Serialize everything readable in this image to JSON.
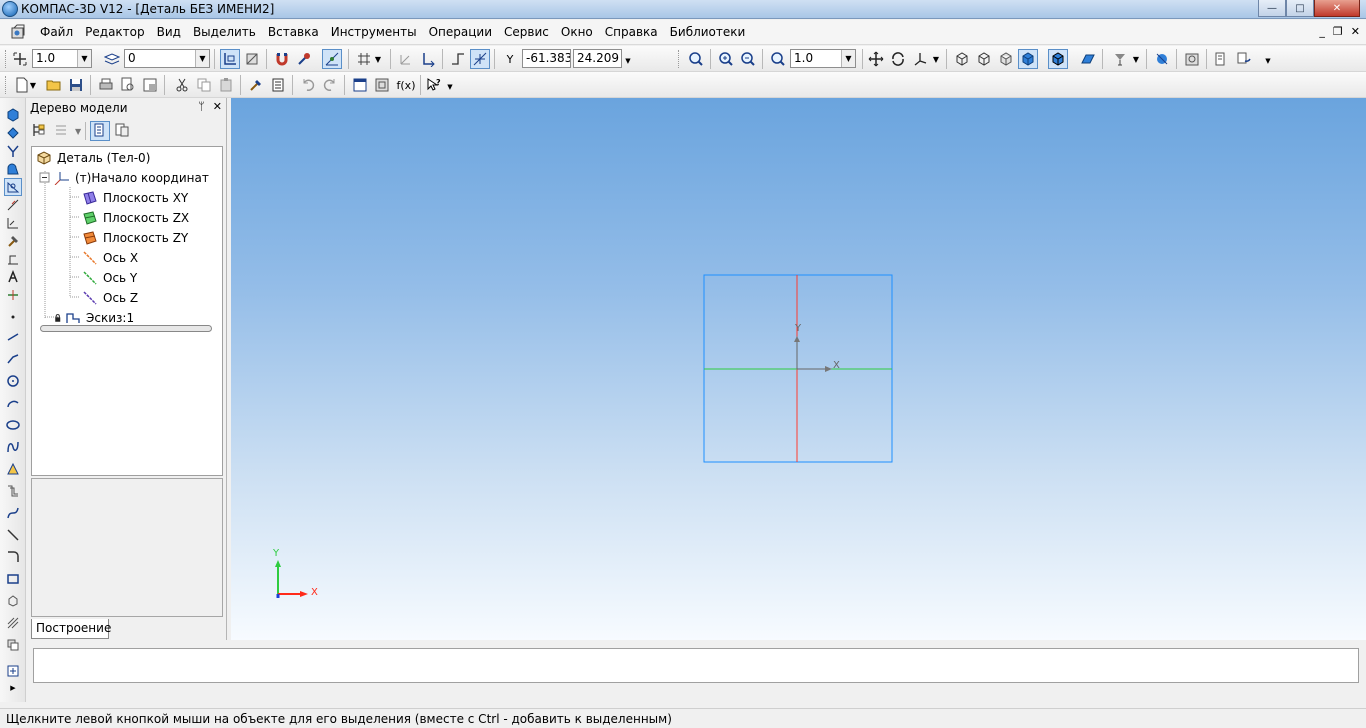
{
  "window": {
    "title": "КОМПАС-3D V12 - [Деталь БЕЗ ИМЕНИ2]",
    "controls": {
      "minimize": "—",
      "maximize": "□",
      "close": "✕"
    }
  },
  "menu": {
    "items": [
      "Файл",
      "Редактор",
      "Вид",
      "Выделить",
      "Вставка",
      "Инструменты",
      "Операции",
      "Сервис",
      "Окно",
      "Справка",
      "Библиотеки"
    ],
    "mdi_controls": {
      "minimize": "_",
      "restore": "❐",
      "close": "✕"
    }
  },
  "toolbar": {
    "step_value": "1.0",
    "layer_value": "0",
    "coord_y_label": "Y",
    "coord_x": "-61.383",
    "coord_y": "24.209",
    "zoom_value": "1.0",
    "fx_label": "f(x)"
  },
  "tree_panel": {
    "title": "Дерево модели",
    "pin": "ᛘ",
    "close": "✕",
    "nodes": [
      {
        "label": "Деталь (Тел-0)",
        "icon": "part-icon"
      },
      {
        "label": "(т)Начало координат",
        "icon": "origin-icon"
      },
      {
        "label": "Плоскость XY",
        "icon": "plane-xy-icon"
      },
      {
        "label": "Плоскость ZX",
        "icon": "plane-zx-icon"
      },
      {
        "label": "Плоскость ZY",
        "icon": "plane-zy-icon"
      },
      {
        "label": "Ось X",
        "icon": "axis-x-icon"
      },
      {
        "label": "Ось Y",
        "icon": "axis-y-icon"
      },
      {
        "label": "Ось Z",
        "icon": "axis-z-icon"
      },
      {
        "label": "Эскиз:1",
        "icon": "sketch-icon"
      }
    ],
    "tab": "Построение"
  },
  "viewport": {
    "sketch_axis_y": "Y",
    "sketch_axis_x": "X",
    "triad_y": "Y",
    "triad_x": "X"
  },
  "status": {
    "message": "Щелкните левой кнопкой мыши на объекте для его выделения (вместе с Ctrl - добавить к выделенным)"
  },
  "colors": {
    "viewport_top": "#6aa4de",
    "viewport_bottom": "#f7fbff",
    "sketch_frame": "#1e90ff",
    "axis_red": "#ff3b2f",
    "axis_green": "#2ecc40"
  }
}
